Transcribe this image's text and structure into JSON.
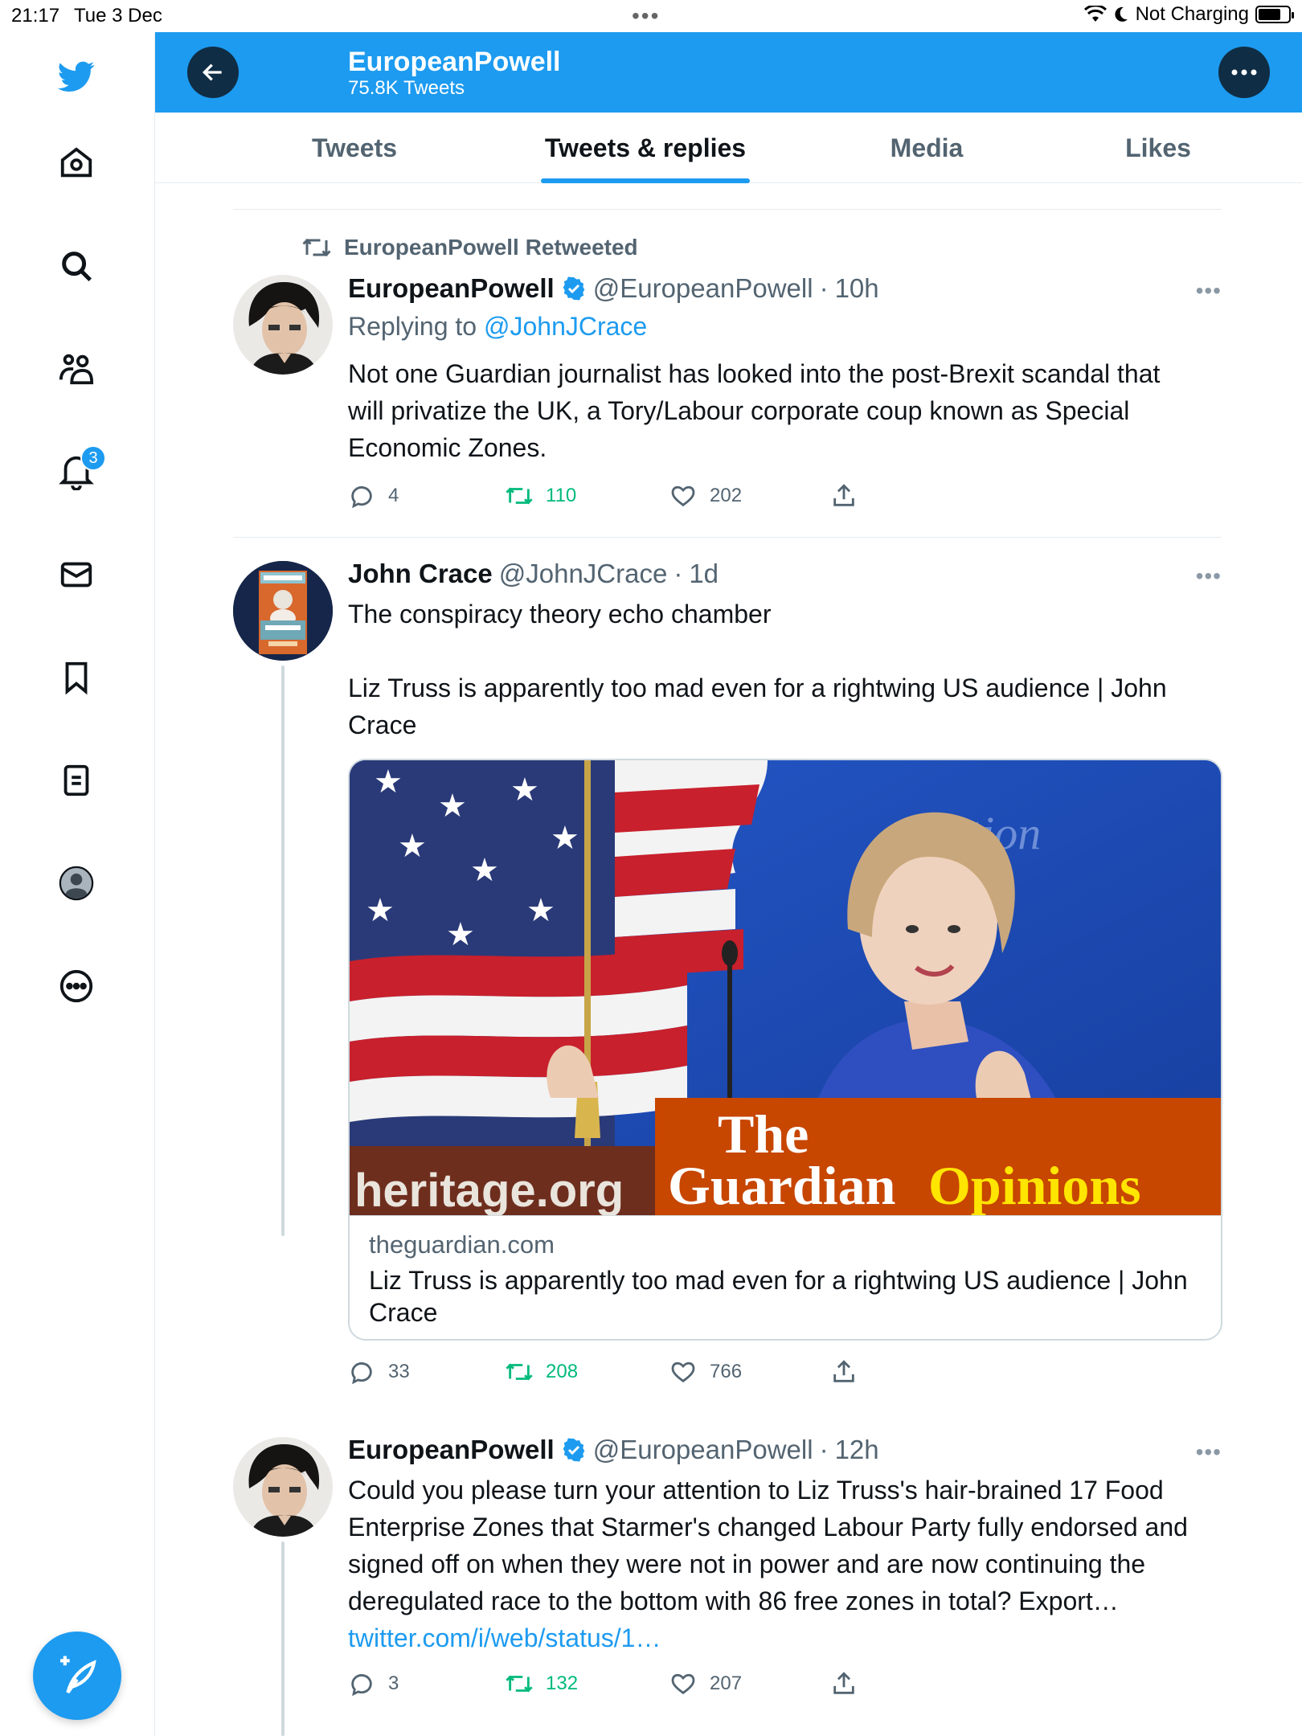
{
  "status_bar": {
    "time": "21:17",
    "date": "Tue 3 Dec",
    "charging": "Not Charging"
  },
  "nav": {
    "notification_badge": "3"
  },
  "header": {
    "title": "EuropeanPowell",
    "subtitle": "75.8K Tweets"
  },
  "tabs": [
    {
      "label": "Tweets",
      "active": false
    },
    {
      "label": "Tweets & replies",
      "active": true
    },
    {
      "label": "Media",
      "active": false
    },
    {
      "label": "Likes",
      "active": false
    }
  ],
  "tweets": [
    {
      "retweeted_by": "EuropeanPowell Retweeted",
      "name": "EuropeanPowell",
      "handle": "@EuropeanPowell",
      "sep": "·",
      "time": "10h",
      "replying_prefix": "Replying to",
      "replying_to": "@JohnJCrace",
      "text": "Not one Guardian journalist has looked into the post-Brexit scandal that will privatize the UK, a Tory/Labour corporate coup known as Special Economic Zones.",
      "replies": "4",
      "retweets": "110",
      "likes": "202"
    },
    {
      "name": "John Crace",
      "handle": "@JohnJCrace",
      "sep": "·",
      "time": "1d",
      "text_line1": "The conspiracy theory echo chamber",
      "text_line2": "Liz Truss is apparently too mad even for a rightwing US audience | John Crace",
      "card": {
        "domain": "theguardian.com",
        "title": "Liz Truss is apparently too mad even for a rightwing US audience | John Crace",
        "image_text_heritage": "heritage.org",
        "image_text_the": "The",
        "image_text_guardian": "Guardian",
        "image_text_opinions": "Opinions",
        "image_text_bg": "tion"
      },
      "replies": "33",
      "retweets": "208",
      "likes": "766"
    },
    {
      "name": "EuropeanPowell",
      "handle": "@EuropeanPowell",
      "sep": "·",
      "time": "12h",
      "text": "Could you please turn your attention to Liz Truss's hair-brained 17 Food Enterprise Zones that Starmer's changed Labour Party fully endorsed and signed off on when they were not in power and are now continuing the deregulated race to the bottom with 86 free zones in total? Export…",
      "link": "twitter.com/i/web/status/1…",
      "replies": "3",
      "retweets": "132",
      "likes": "207"
    }
  ],
  "colors": {
    "brand": "#1d9bf0",
    "retweet": "#00ba7c",
    "guardian_orange": "#c74600",
    "guardian_yellow": "#ffe500"
  },
  "icons": [
    "twitter-logo-icon",
    "home-icon",
    "search-icon",
    "communities-icon",
    "bell-icon",
    "mail-icon",
    "bookmark-icon",
    "lists-icon",
    "profile-icon",
    "more-circle-icon",
    "compose-icon",
    "back-arrow-icon",
    "more-dots-icon",
    "retweet-icon",
    "verified-icon",
    "reply-icon",
    "like-icon",
    "share-icon"
  ]
}
